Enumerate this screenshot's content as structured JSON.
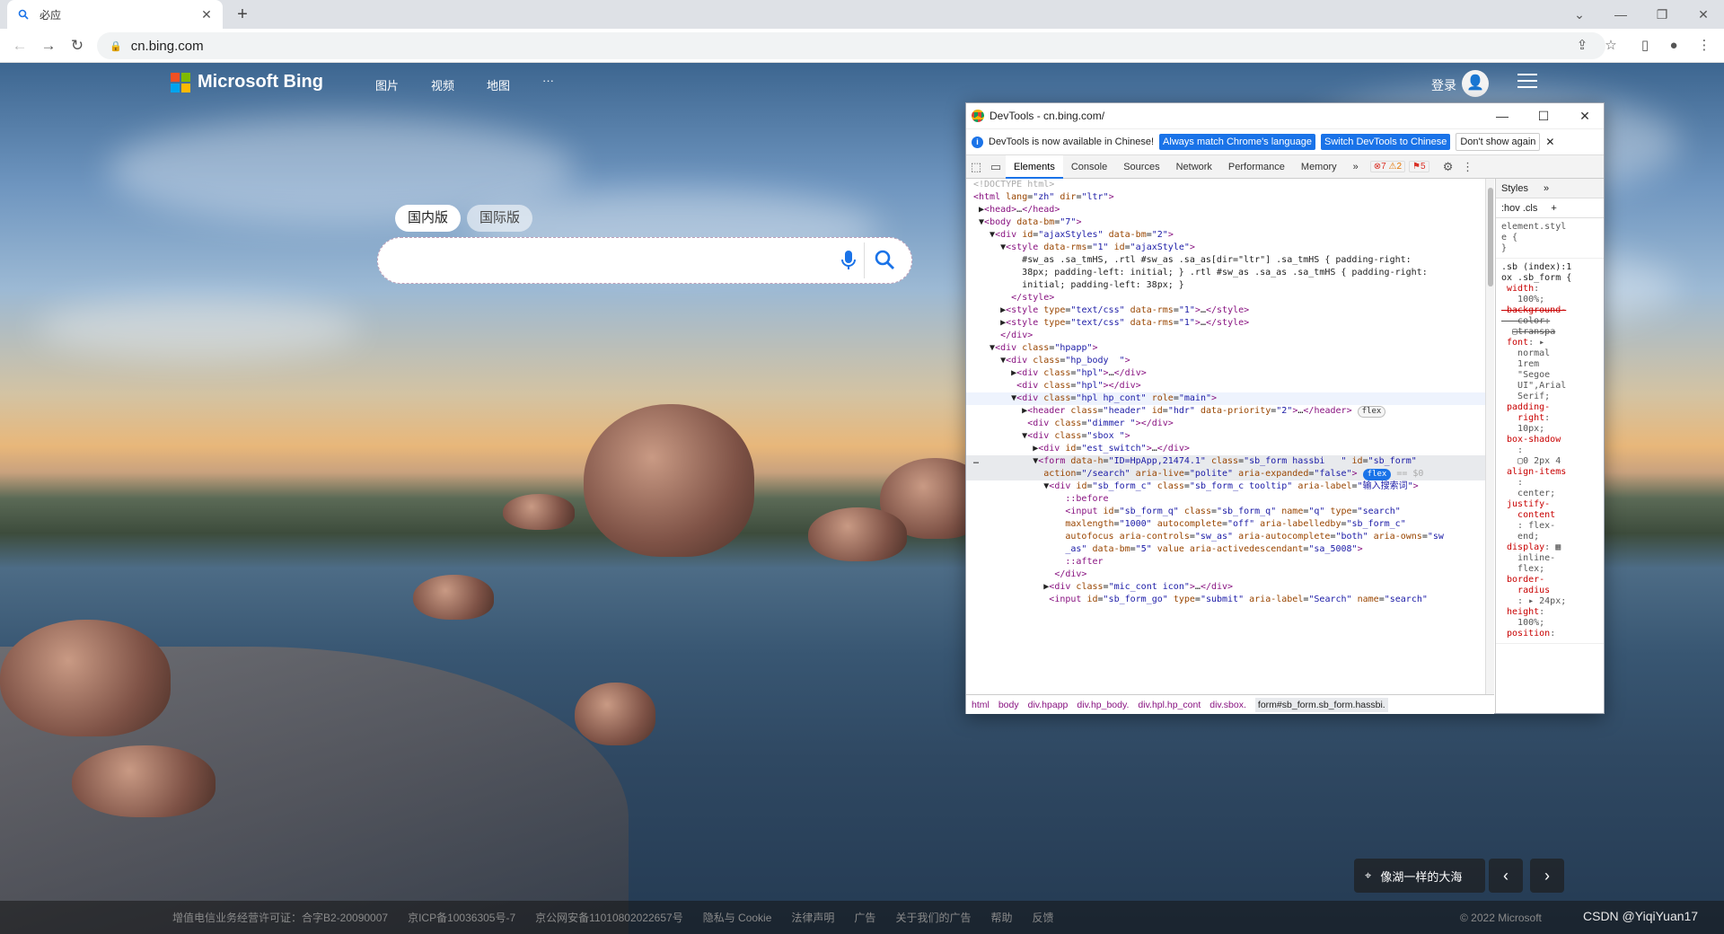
{
  "browser": {
    "tab_title": "必应",
    "new_tab": "+",
    "address": "cn.bing.com"
  },
  "bing": {
    "logo_text": "Microsoft Bing",
    "nav": [
      "图片",
      "视频",
      "地图",
      "···"
    ],
    "signin": "登录",
    "region_cn": "国内版",
    "region_intl": "国际版",
    "search_value": "",
    "image_caption": "像湖一样的大海"
  },
  "devtools": {
    "window_title": "DevTools - cn.bing.com/",
    "info_text": "DevTools is now available in Chinese!",
    "info_btn_match": "Always match Chrome's language",
    "info_btn_switch": "Switch DevTools to Chinese",
    "info_btn_dismiss": "Don't show again",
    "tabs": [
      "Elements",
      "Console",
      "Sources",
      "Network",
      "Performance",
      "Memory",
      "»"
    ],
    "errors": "7",
    "warnings": "2",
    "issues": "5",
    "styles_tab": "Styles",
    "styles_more": "»",
    "styles_filters": ":hov  .cls",
    "breadcrumb": [
      "html",
      "body",
      "div.hpapp",
      "div.hp_body.",
      "div.hpl.hp_cont",
      "div.sbox.",
      "form#sb_form.sb_form.hassbi."
    ]
  },
  "footer": {
    "links": [
      "增值电信业务经营许可证：合字B2-20090007",
      "京ICP备10036305号-7",
      "京公网安备11010802022657号",
      "隐私与 Cookie",
      "法律声明",
      "广告",
      "关于我们的广告",
      "帮助",
      "反馈"
    ],
    "copyright": "© 2022 Microsoft",
    "watermark": "CSDN @YiqiYuan17"
  },
  "colors": {
    "ms_red": "#f25022",
    "ms_green": "#7fba00",
    "ms_blue": "#00a4ef",
    "ms_yellow": "#ffb900",
    "devtools_accent": "#1a73e8"
  }
}
